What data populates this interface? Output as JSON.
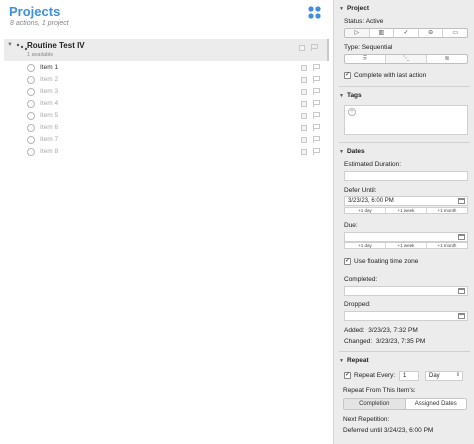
{
  "outline": {
    "title": "Projects",
    "subtitle": "8 actions, 1 project",
    "project": {
      "title": "Routine Test IV",
      "sub": "1 available"
    },
    "items": [
      "Item 1",
      "Item 2",
      "Item 3",
      "Item 4",
      "Item 5",
      "Item 6",
      "Item 7",
      "Item 8"
    ]
  },
  "inspector": {
    "project_header": "Project",
    "status_label": "Status:",
    "status_value": "Active",
    "type_label": "Type:",
    "type_value": "Sequential",
    "complete_with_last": "Complete with last action",
    "tags_header": "Tags",
    "tag_add": "+",
    "dates_header": "Dates",
    "est_duration": "Estimated Duration:",
    "defer_until": "Defer Until:",
    "defer_value": "3/23/23, 6:00 PM",
    "plus_day": "+1 day",
    "plus_week": "+1 week",
    "plus_month": "+1 month",
    "due": "Due:",
    "floating_tz": "Use floating time zone",
    "completed": "Completed:",
    "dropped": "Dropped:",
    "added_label": "Added:",
    "added_value": "3/23/23, 7:32 PM",
    "changed_label": "Changed:",
    "changed_value": "3/23/23, 7:35 PM",
    "repeat_header": "Repeat",
    "repeat_every": "Repeat Every:",
    "repeat_num": "1",
    "repeat_unit": "Day",
    "repeat_from": "Repeat From This Item's:",
    "completion": "Completion",
    "assigned_dates": "Assigned Dates",
    "next_rep": "Next Repetition:",
    "deferred_until": "Deferred until 3/24/23, 6:00 PM"
  },
  "colors": {
    "accent": "#3f8fdf"
  }
}
